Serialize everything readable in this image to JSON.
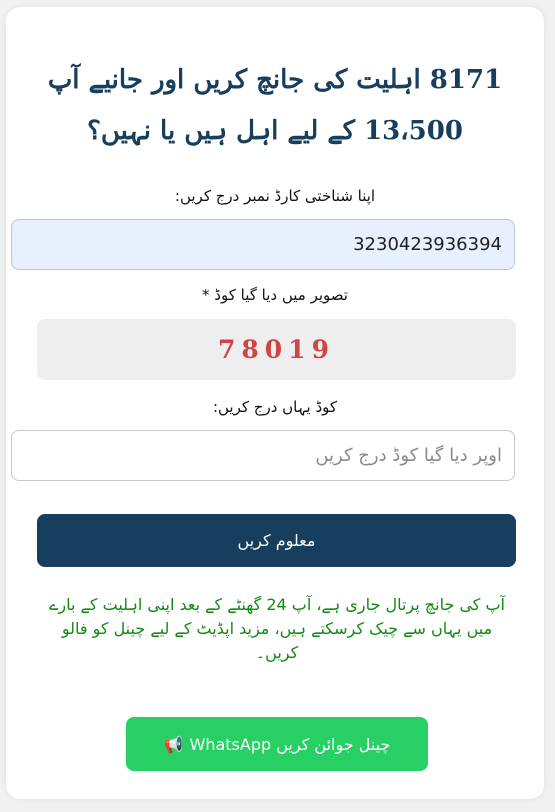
{
  "form": {
    "title_line1": "8171 اہلیت کی جانچ کریں اور جانیے آپ",
    "title_line2": "13،500 کے لیے اہل ہیں یا نہیں؟",
    "cnic_label": "اپنا شناختی کارڈ نمبر درج کریں:",
    "cnic_value": "3230423936394",
    "captcha_label": "تصویر میں دیا گیا کوڈ *",
    "captcha_code": "78019",
    "code_label": "کوڈ یہاں درج کریں:",
    "code_placeholder": "اوپر دیا گیا کوڈ درج کریں",
    "submit_label": "معلوم کریں"
  },
  "info_text": "آپ کی جانچ پرتال جاری ہے، آپ 24 گھنٹے کے بعد اپنی اہلیت کے بارے میں یہاں سے چیک کرسکتے ہیں، مزید اپڈیٹ کے لیے چینل کو فالو کریں۔",
  "whatsapp": {
    "label": "WhatsApp چینل جوائن کریں",
    "icon": "megaphone-icon",
    "color": "#27cf64"
  },
  "colors": {
    "title": "#173e5c",
    "button": "#173e5c",
    "captcha": "#cf4545",
    "info": "#118a11"
  }
}
